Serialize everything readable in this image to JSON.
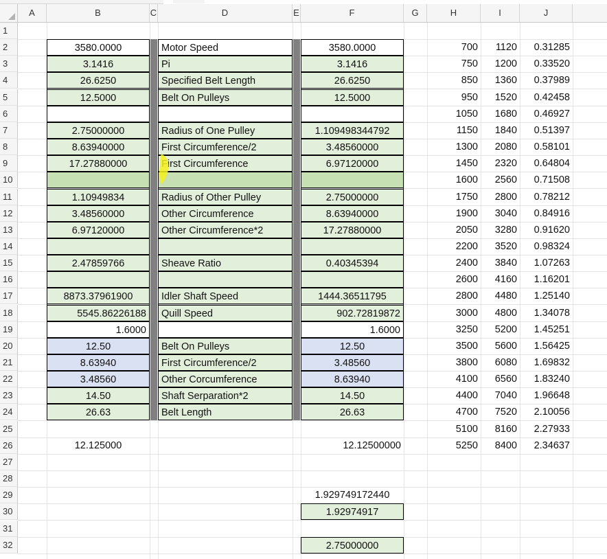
{
  "columns": [
    "A",
    "B",
    "C",
    "D",
    "E",
    "F",
    "G",
    "H",
    "I",
    "J"
  ],
  "rows": [
    "1",
    "2",
    "3",
    "4",
    "5",
    "6",
    "7",
    "8",
    "9",
    "10",
    "11",
    "12",
    "13",
    "14",
    "15",
    "16",
    "17",
    "18",
    "19",
    "20",
    "21",
    "22",
    "23",
    "24",
    "25",
    "26",
    "27",
    "28",
    "29",
    "30",
    "31",
    "32"
  ],
  "colB": {
    "r2": "3580.0000",
    "r3": "3.1416",
    "r4": "26.6250",
    "r5": "12.5000",
    "r7": "2.75000000",
    "r8": "8.63940000",
    "r9": "17.27880000",
    "r11": "1.10949834",
    "r12": "3.48560000",
    "r13": "6.97120000",
    "r15": "2.47859766",
    "r17": "8873.37961900",
    "r18": "5545.86226188",
    "r19": "1.6000",
    "r20": "12.50",
    "r21": "8.63940",
    "r22": "3.48560",
    "r23": "14.50",
    "r24": "26.63",
    "r26": "12.125000"
  },
  "colD": {
    "r2": "Motor Speed",
    "r3": "Pi",
    "r4": "Specified Belt Length",
    "r5": "Belt On Pulleys",
    "r7": "Radius of One Pulley",
    "r8": "First Circumference/2",
    "r9": "First Circumference",
    "r11": "Radius of Other  Pulley",
    "r12": "Other Circumference",
    "r13": "Other  Circumference*2",
    "r15": "Sheave Ratio",
    "r17": "Idler Shaft Speed",
    "r18": "Quill Speed",
    "r20": "Belt On Pulleys",
    "r21": "First Circumference/2",
    "r22": "Other Corcumference",
    "r23": "Shaft Serparation*2",
    "r24": "Belt Length"
  },
  "colF": {
    "r2": "3580.0000",
    "r3": "3.1416",
    "r4": "26.6250",
    "r5": "12.5000",
    "r7": "1.109498344792",
    "r8": "3.48560000",
    "r9": "6.97120000",
    "r11": "2.75000000",
    "r12": "8.63940000",
    "r13": "17.27880000",
    "r15": "0.40345394",
    "r17": "1444.36511795",
    "r18": "902.72819872",
    "r19": "1.6000",
    "r20": "12.50",
    "r21": "3.48560",
    "r22": "8.63940",
    "r23": "14.50",
    "r24": "26.63",
    "r26": "12.12500000",
    "r29": "1.929749172440",
    "r30": "1.92974917",
    "r32": "2.75000000"
  },
  "colH": [
    "700",
    "750",
    "850",
    "950",
    "1050",
    "1150",
    "1300",
    "1450",
    "1600",
    "1750",
    "1900",
    "2050",
    "2200",
    "2400",
    "2600",
    "2800",
    "3000",
    "3250",
    "3500",
    "3800",
    "4100",
    "4400",
    "4700",
    "5100",
    "5250"
  ],
  "colI": [
    "1120",
    "1200",
    "1360",
    "1520",
    "1680",
    "1840",
    "2080",
    "2320",
    "2560",
    "2800",
    "3040",
    "3280",
    "3520",
    "3840",
    "4160",
    "4480",
    "4800",
    "5200",
    "5600",
    "6080",
    "6560",
    "7040",
    "7520",
    "8160",
    "8400"
  ],
  "colJ": [
    "0.31285",
    "0.33520",
    "0.37989",
    "0.42458",
    "0.46927",
    "0.51397",
    "0.58101",
    "0.64804",
    "0.71508",
    "0.78212",
    "0.84916",
    "0.91620",
    "0.98324",
    "1.07263",
    "1.16201",
    "1.25140",
    "1.34078",
    "1.45251",
    "1.56425",
    "1.69832",
    "1.83240",
    "1.96648",
    "2.10056",
    "2.27933",
    "2.34637"
  ],
  "colors": {
    "green": "#e2efda",
    "green_dark": "#c6e0b4",
    "blue": "#d9e1f2",
    "bar": "#808080",
    "highlight": "#f5f01e"
  }
}
